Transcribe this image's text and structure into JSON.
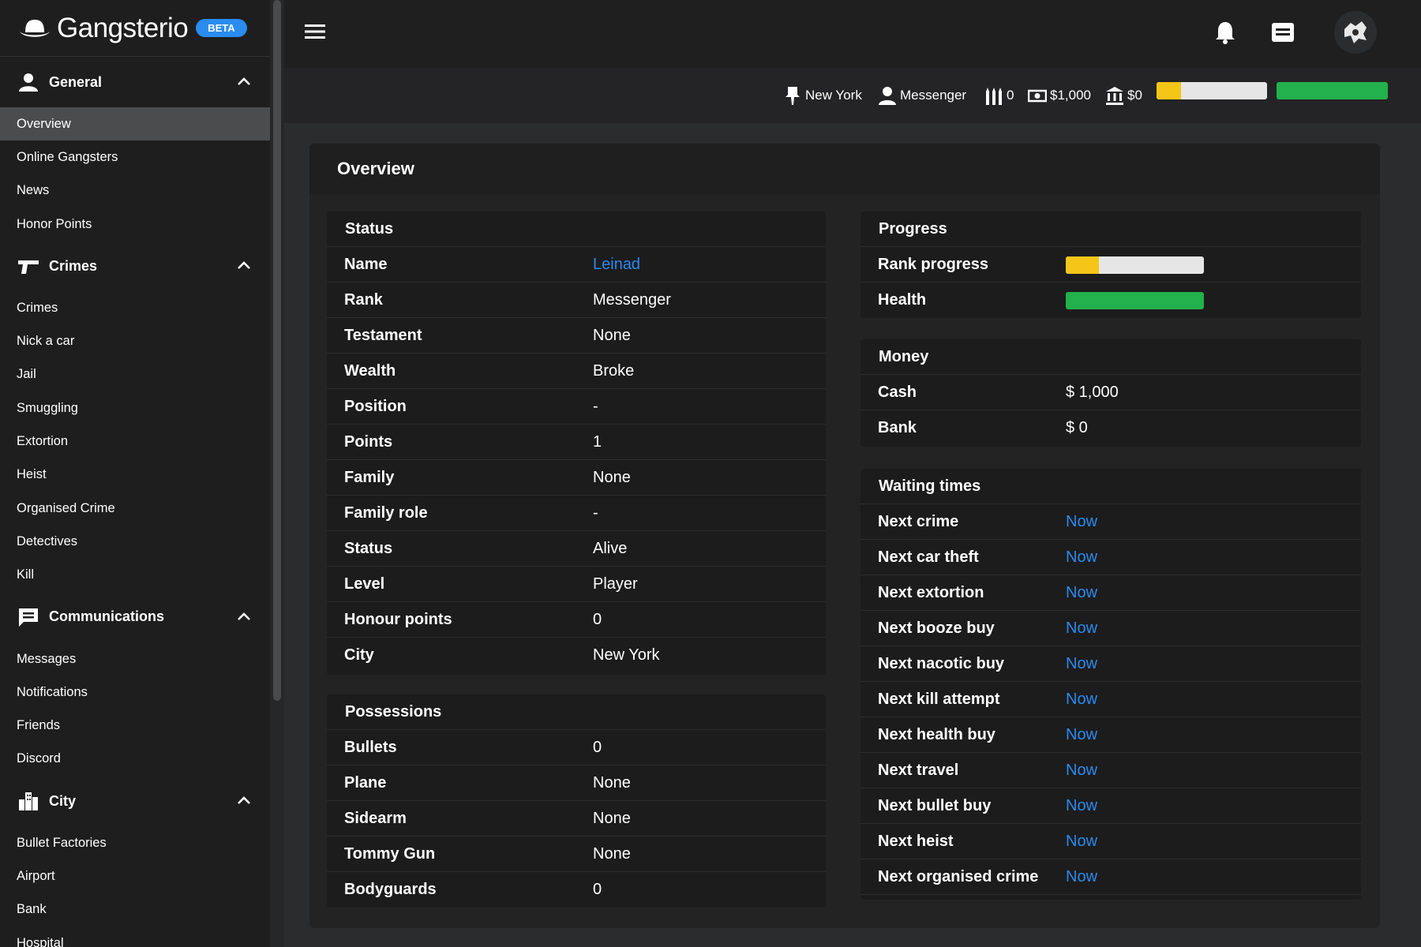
{
  "brand": {
    "name": "Gangsterio",
    "badge": "BETA"
  },
  "sidebar": {
    "sections": [
      {
        "label": "General",
        "items": [
          "Overview",
          "Online Gangsters",
          "News",
          "Honor Points"
        ]
      },
      {
        "label": "Crimes",
        "items": [
          "Crimes",
          "Nick a car",
          "Jail",
          "Smuggling",
          "Extortion",
          "Heist",
          "Organised Crime",
          "Detectives",
          "Kill"
        ]
      },
      {
        "label": "Communications",
        "items": [
          "Messages",
          "Notifications",
          "Friends",
          "Discord"
        ]
      },
      {
        "label": "City",
        "items": [
          "Bullet Factories",
          "Airport",
          "Bank",
          "Hospital"
        ]
      }
    ],
    "active": "Overview"
  },
  "statusbar": {
    "city": "New York",
    "rank": "Messenger",
    "bullets": "0",
    "cash": "$1,000",
    "bank": "$0",
    "rank_progress": 0.22,
    "health": 1.0
  },
  "colors": {
    "accent": "#2b8af0",
    "rank_bar": "#f5c518",
    "health_bar": "#22b14c",
    "bar_bg": "#e6e6e6"
  },
  "panel_title": "Overview",
  "status_card": {
    "title": "Status",
    "rows": [
      {
        "k": "Name",
        "v": "Leinad",
        "link": true
      },
      {
        "k": "Rank",
        "v": "Messenger"
      },
      {
        "k": "Testament",
        "v": "None"
      },
      {
        "k": "Wealth",
        "v": "Broke"
      },
      {
        "k": "Position",
        "v": "-"
      },
      {
        "k": "Points",
        "v": "1"
      },
      {
        "k": "Family",
        "v": "None"
      },
      {
        "k": "Family role",
        "v": "-"
      },
      {
        "k": "Status",
        "v": "Alive"
      },
      {
        "k": "Level",
        "v": "Player"
      },
      {
        "k": "Honour points",
        "v": "0"
      },
      {
        "k": "City",
        "v": "New York"
      }
    ]
  },
  "possessions_card": {
    "title": "Possessions",
    "rows": [
      {
        "k": "Bullets",
        "v": "0"
      },
      {
        "k": "Plane",
        "v": "None"
      },
      {
        "k": "Sidearm",
        "v": "None"
      },
      {
        "k": "Tommy Gun",
        "v": "None"
      },
      {
        "k": "Bodyguards",
        "v": "0"
      }
    ]
  },
  "progress_card": {
    "title": "Progress",
    "rank_label": "Rank progress",
    "health_label": "Health",
    "rank_value": 0.24,
    "health_value": 1.0
  },
  "money_card": {
    "title": "Money",
    "rows": [
      {
        "k": "Cash",
        "v": "$ 1,000"
      },
      {
        "k": "Bank",
        "v": "$ 0"
      }
    ]
  },
  "waiting_card": {
    "title": "Waiting times",
    "rows": [
      {
        "k": "Next crime",
        "v": "Now"
      },
      {
        "k": "Next car theft",
        "v": "Now"
      },
      {
        "k": "Next extortion",
        "v": "Now"
      },
      {
        "k": "Next booze buy",
        "v": "Now"
      },
      {
        "k": "Next nacotic buy",
        "v": "Now"
      },
      {
        "k": "Next kill attempt",
        "v": "Now"
      },
      {
        "k": "Next health buy",
        "v": "Now"
      },
      {
        "k": "Next travel",
        "v": "Now"
      },
      {
        "k": "Next bullet buy",
        "v": "Now"
      },
      {
        "k": "Next heist",
        "v": "Now"
      },
      {
        "k": "Next organised crime",
        "v": "Now"
      }
    ]
  }
}
